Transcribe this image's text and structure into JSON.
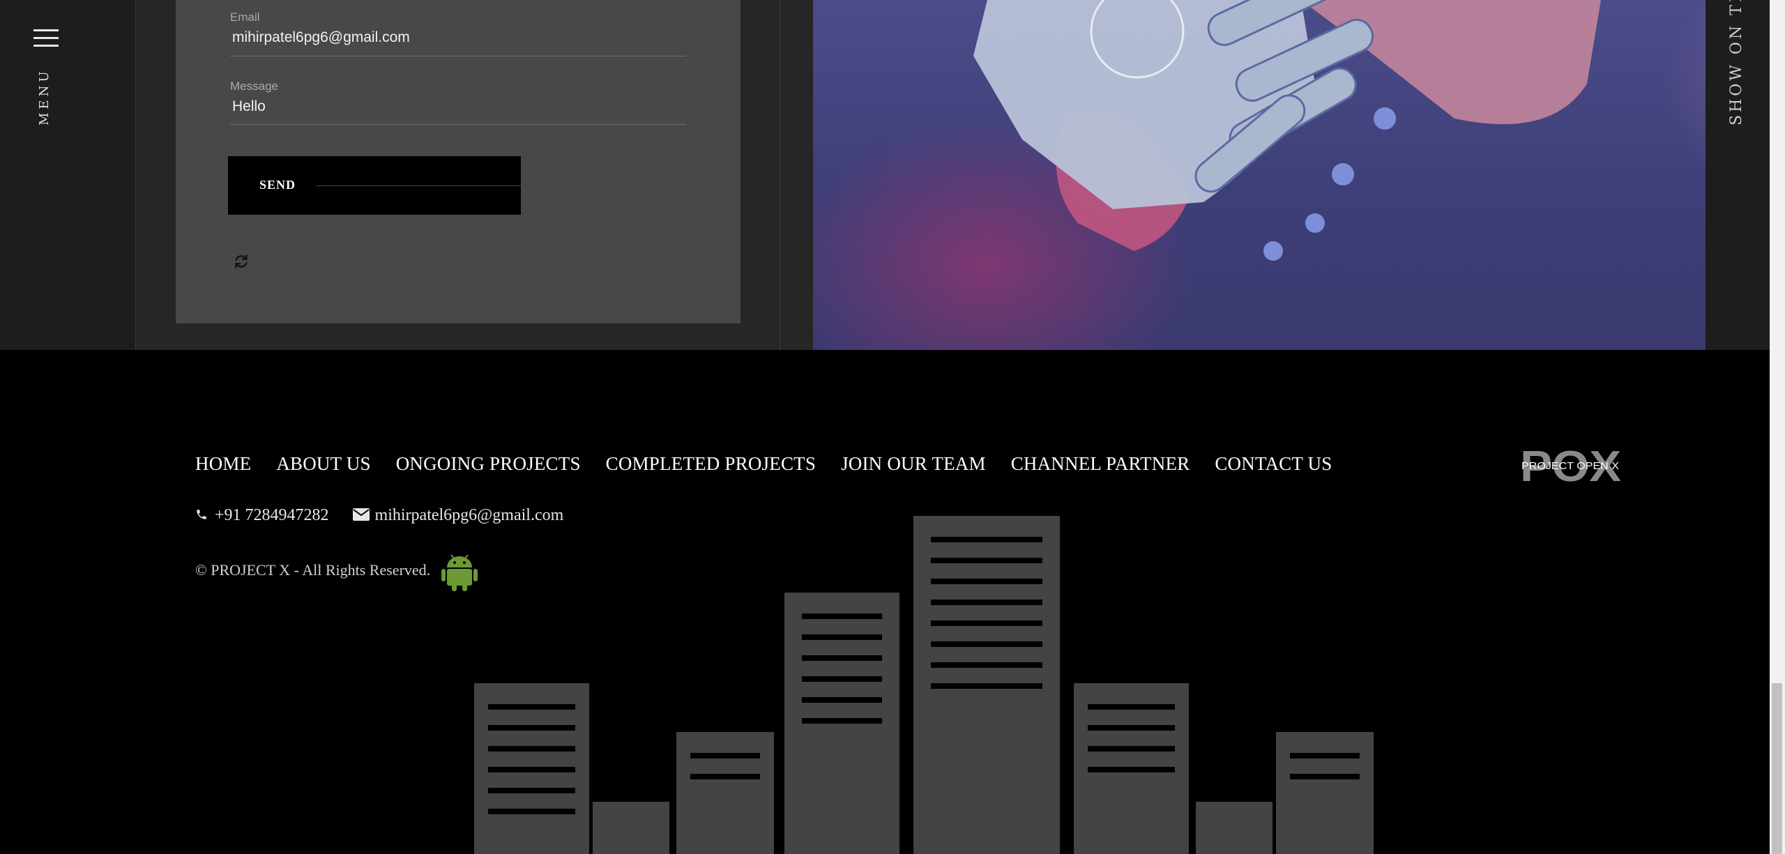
{
  "left_menu": {
    "label": "MENU"
  },
  "contact_form": {
    "email": {
      "label": "Email",
      "value": "mihirpatel6pg6@gmail.com"
    },
    "message": {
      "label": "Message",
      "value": "Hello"
    },
    "send_label": "SEND"
  },
  "right_rail": {
    "text": "SHOW ON THE"
  },
  "footer": {
    "nav": [
      "HOME",
      "ABOUT US",
      "ONGOING PROJECTS",
      "COMPLETED PROJECTS",
      "JOIN OUR TEAM",
      "CHANNEL PARTNER",
      "CONTACT US"
    ],
    "logo": {
      "main": "POX",
      "tagline": "PROJECT OPEN X"
    },
    "phone": "+91 7284947282",
    "email": "mihirpatel6pg6@gmail.com",
    "copyright": "© PROJECT X - All Rights Reserved."
  },
  "colors": {
    "android_green": "#6d9a36",
    "form_card": "#474848",
    "hero_purple": "#3e3e78"
  },
  "icons": [
    "hamburger-icon",
    "refresh-icon",
    "phone-icon",
    "envelope-icon",
    "android-icon"
  ]
}
